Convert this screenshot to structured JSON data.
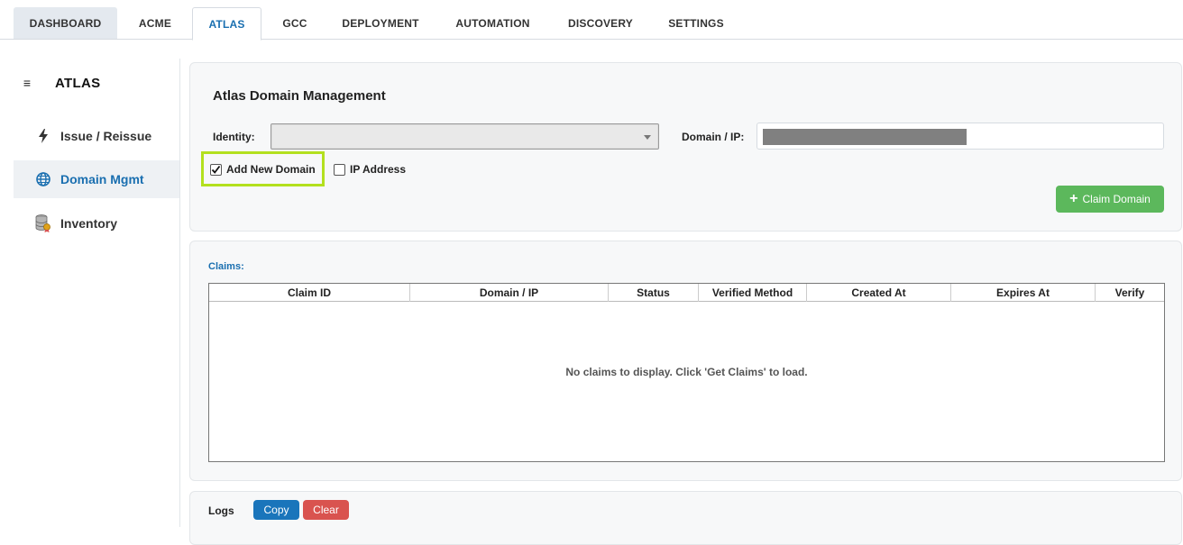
{
  "tabs": [
    {
      "label": "DASHBOARD"
    },
    {
      "label": "ACME"
    },
    {
      "label": "ATLAS",
      "active": true
    },
    {
      "label": "GCC"
    },
    {
      "label": "DEPLOYMENT"
    },
    {
      "label": "AUTOMATION"
    },
    {
      "label": "DISCOVERY"
    },
    {
      "label": "SETTINGS"
    }
  ],
  "sidebar": {
    "title": "ATLAS",
    "items": [
      {
        "label": "Issue / Reissue",
        "icon": "lightning-icon"
      },
      {
        "label": "Domain Mgmt",
        "icon": "globe-icon",
        "active": true
      },
      {
        "label": "Inventory",
        "icon": "database-certificate-icon"
      }
    ]
  },
  "domain_panel": {
    "title": "Atlas Domain Management",
    "identity_label": "Identity:",
    "identity_value": "",
    "domain_label": "Domain / IP:",
    "add_new_domain_label": "Add New Domain",
    "add_new_domain_checked": true,
    "ip_address_label": "IP Address",
    "ip_address_checked": false,
    "claim_button_label": "Claim Domain"
  },
  "claims": {
    "label": "Claims:",
    "columns": [
      "Claim ID",
      "Domain / IP",
      "Status",
      "Verified Method",
      "Created At",
      "Expires At",
      "Verify"
    ],
    "empty_message": "No claims to display. Click 'Get Claims' to load."
  },
  "logs": {
    "label": "Logs",
    "copy_label": "Copy",
    "clear_label": "Clear"
  },
  "colors": {
    "accent": "#1a6fb0",
    "success": "#5cb85c",
    "danger": "#d9534f",
    "highlight": "#b3e01e"
  }
}
